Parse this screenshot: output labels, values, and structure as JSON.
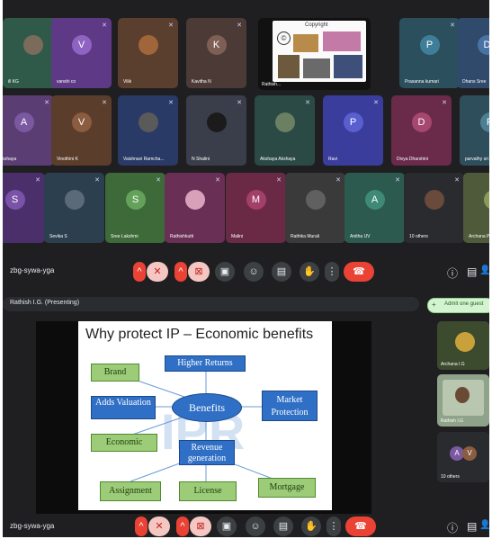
{
  "gallery": {
    "rows": [
      [
        {
          "name": "ill KG",
          "initial": "",
          "bg": "#2f5a4a",
          "avatar_bg": "#7a6b5b"
        },
        {
          "name": "vanshi co",
          "initial": "V",
          "bg": "#5e3a86",
          "avatar_bg": "#8e63c1"
        },
        {
          "name": "Vilik",
          "initial": "",
          "bg": "#5a3e2e",
          "avatar_bg": "#a0663a"
        },
        {
          "name": "Kavitha N",
          "initial": "K",
          "bg": "#4b3a36",
          "avatar_bg": "#7e5f56"
        },
        {
          "name": "Prasanna kumari",
          "initial": "P",
          "bg": "#2c4f5e",
          "avatar_bg": "#3f7e98"
        },
        {
          "name": "Dhans Sree",
          "initial": "D",
          "bg": "#2f4a6a",
          "avatar_bg": "#4a72a5"
        }
      ],
      [
        {
          "name": "Akshaya",
          "initial": "A",
          "bg": "#5a3e73",
          "avatar_bg": "#7b59a0"
        },
        {
          "name": "Vinothini K",
          "initial": "V",
          "bg": "#5b3d2b",
          "avatar_bg": "#8a5c40"
        },
        {
          "name": "Vaishnavi Ramcha...",
          "initial": "",
          "bg": "#2a3a66",
          "avatar_bg": "#5a5a5a"
        },
        {
          "name": "N Shalini",
          "initial": "",
          "bg": "#3a3e4a",
          "avatar_bg": "#1b1b1b"
        },
        {
          "name": "Akshaya Akshaya",
          "initial": "",
          "bg": "#2b4a45",
          "avatar_bg": "#6b7f63"
        },
        {
          "name": "Ravi",
          "initial": "P",
          "bg": "#3a3d9c",
          "avatar_bg": "#5a5fd0"
        },
        {
          "name": "Divya Dharshini",
          "initial": "D",
          "bg": "#6a2a4a",
          "avatar_bg": "#a5476f"
        },
        {
          "name": "parvathy sri",
          "initial": "P",
          "bg": "#2f4e5c",
          "avatar_bg": "#4d7f93"
        }
      ],
      [
        {
          "name": "",
          "initial": "S",
          "bg": "#4b2f6a",
          "avatar_bg": "#7a53a8"
        },
        {
          "name": "Sevika S",
          "initial": "",
          "bg": "#2c3f4f",
          "avatar_bg": "#5b6a78"
        },
        {
          "name": "Sree Lakshmi",
          "initial": "S",
          "bg": "#3e6a3a",
          "avatar_bg": "#64a25c"
        },
        {
          "name": "Rathishkutti",
          "initial": "",
          "bg": "#6a2f55",
          "avatar_bg": "#d9a0b9"
        },
        {
          "name": "Malini",
          "initial": "M",
          "bg": "#6a2a45",
          "avatar_bg": "#a3406a"
        },
        {
          "name": "Rathika Murali",
          "initial": "",
          "bg": "#3a3a3a",
          "avatar_bg": "#606060"
        },
        {
          "name": "Anitha UV",
          "initial": "A",
          "bg": "#2c5a4e",
          "avatar_bg": "#3f8a76"
        },
        {
          "name": "10 others",
          "initial": "",
          "bg": "#2a2b2e",
          "avatar_bg": "#6a4a3a"
        },
        {
          "name": "Archana P",
          "initial": "",
          "bg": "#4e5a3a",
          "avatar_bg": "#8a9a5a"
        }
      ]
    ],
    "share_tile": {
      "name": "Rathish...",
      "slide_heading": "Copyright",
      "symbol": "©"
    }
  },
  "top_controls": {
    "meeting_code": "zbg-sywa-yga",
    "icons": [
      "chevron-up-icon",
      "mic-off-icon",
      "chevron-up-icon",
      "camera-off-icon",
      "captions-icon",
      "emoji-icon",
      "present-icon",
      "raise-hand-icon",
      "more-icon",
      "end-call-icon"
    ],
    "glyphs": {
      "chevron": "^",
      "mic_off": "✕",
      "cam_off": "⊠",
      "captions": "▣",
      "emoji": "☺",
      "present": "▤",
      "hand": "✋",
      "more": "⋮",
      "end": "☎"
    },
    "right_icons": {
      "info": "ⓘ",
      "chat": "▤",
      "people": "👤"
    }
  },
  "presenting": {
    "label": "Rathish I.G. (Presenting)",
    "admit_button": "Admit one guest"
  },
  "slide": {
    "title": "Why protect IP – Economic benefits",
    "watermark": "IPR",
    "center": "Benefits",
    "nodes": {
      "brand": "Brand",
      "higher_returns": "Higher Returns",
      "adds_valuation": "Adds Valuation",
      "market_protection": "Market Protection",
      "economic": "Economic",
      "revenue_generation": "Revenue generation",
      "assignment": "Assignment",
      "license": "License",
      "mortgage": "Mortgage"
    }
  },
  "side_tiles": {
    "tile1": {
      "name": "Archana I.G"
    },
    "tile2": {
      "name": "Rathish I.G"
    },
    "tile3": {
      "name": "10 others",
      "initials": [
        "A",
        "V"
      ]
    }
  },
  "bottom_controls": {
    "meeting_code": "zbg-sywa-yga"
  }
}
